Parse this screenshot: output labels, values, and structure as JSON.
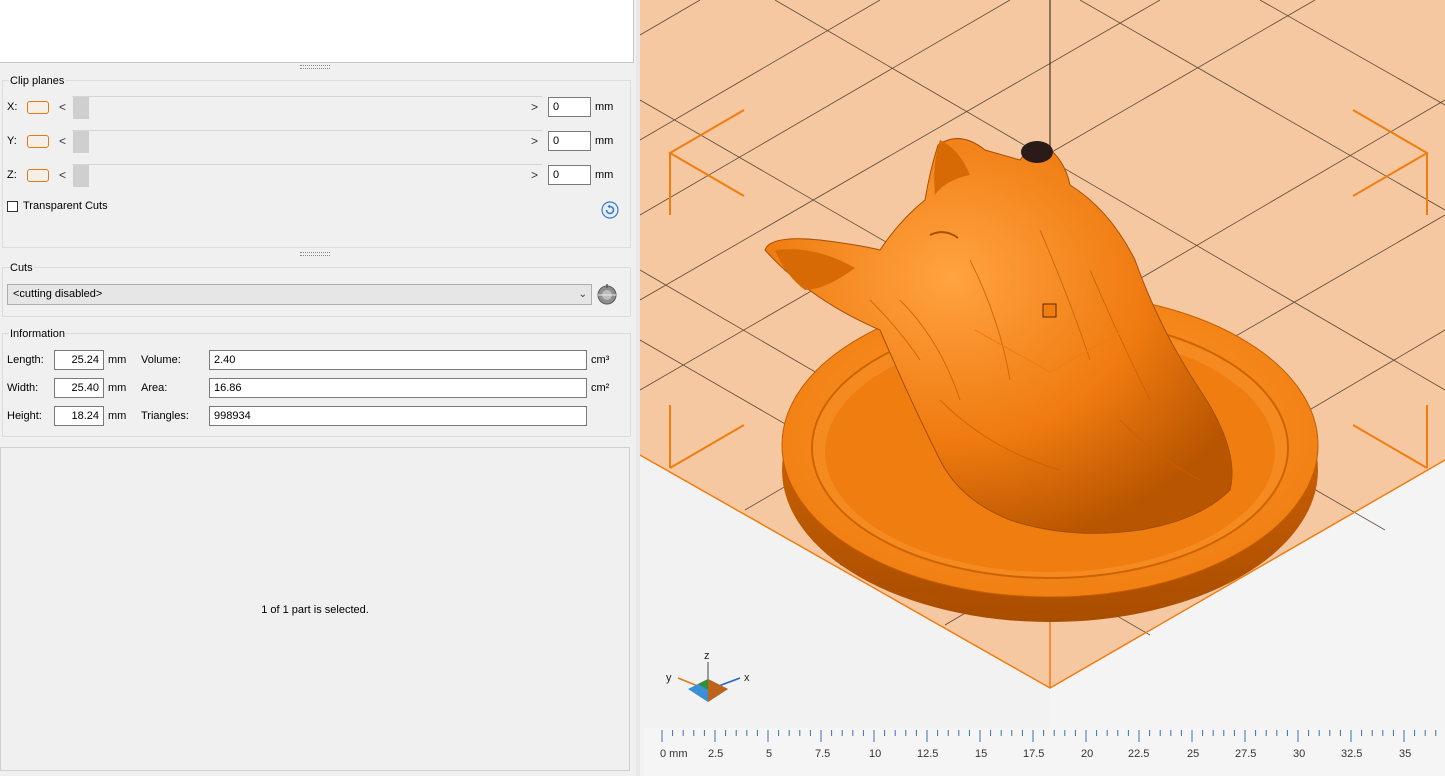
{
  "clip_planes": {
    "title": "Clip planes",
    "unit": "mm",
    "rows": [
      {
        "axis": "X:",
        "value": "0"
      },
      {
        "axis": "Y:",
        "value": "0"
      },
      {
        "axis": "Z:",
        "value": "0"
      }
    ],
    "transparent_cuts_label": "Transparent Cuts",
    "transparent_cuts_checked": false,
    "arrow_left": "<",
    "arrow_right": ">"
  },
  "cuts": {
    "title": "Cuts",
    "selected": "<cutting disabled>"
  },
  "information": {
    "title": "Information",
    "length_label": "Length:",
    "length_value": "25.24",
    "width_label": "Width:",
    "width_value": "25.40",
    "height_label": "Height:",
    "height_value": "18.24",
    "dim_unit": "mm",
    "volume_label": "Volume:",
    "volume_value": "2.40",
    "volume_unit": "cm³",
    "area_label": "Area:",
    "area_value": "16.86",
    "area_unit": "cm²",
    "triangles_label": "Triangles:",
    "triangles_value": "998934"
  },
  "selection_status": "1 of 1 part is selected.",
  "axis_gizmo": {
    "x": "x",
    "y": "y",
    "z": "z"
  },
  "ruler": {
    "labels": [
      "0 mm",
      "2.5",
      "5",
      "7.5",
      "10",
      "12.5",
      "15",
      "17.5",
      "20",
      "22.5",
      "25",
      "27.5",
      "30",
      "32.5",
      "35"
    ]
  },
  "colors": {
    "model": "#f07d10",
    "build_plate": "#f5c8a2",
    "accent": "#e07a1a"
  }
}
